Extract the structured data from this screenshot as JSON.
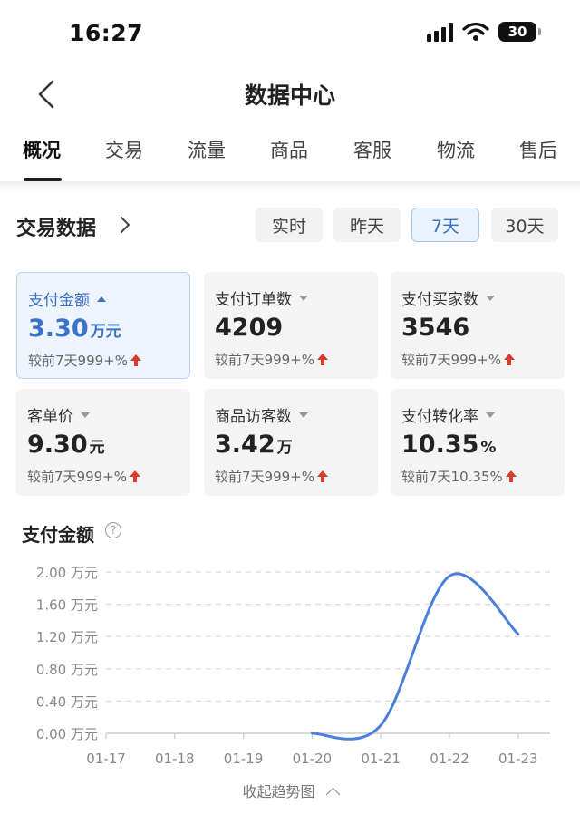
{
  "status_bar": {
    "time": "16:27",
    "battery": "30"
  },
  "nav": {
    "title": "数据中心"
  },
  "tabs": [
    {
      "label": "概况",
      "active": true
    },
    {
      "label": "交易"
    },
    {
      "label": "流量"
    },
    {
      "label": "商品"
    },
    {
      "label": "客服"
    },
    {
      "label": "物流"
    },
    {
      "label": "售后"
    }
  ],
  "section": {
    "title": "交易数据",
    "ranges": [
      {
        "label": "实时"
      },
      {
        "label": "昨天"
      },
      {
        "label": "7天",
        "active": true
      },
      {
        "label": "30天"
      }
    ]
  },
  "metrics": [
    {
      "label": "支付金额",
      "value": "3.30",
      "unit": "万元",
      "compare": "较前7天999+%",
      "active": true
    },
    {
      "label": "支付订单数",
      "value": "4209",
      "unit": "",
      "compare": "较前7天999+%"
    },
    {
      "label": "支付买家数",
      "value": "3546",
      "unit": "",
      "compare": "较前7天999+%"
    },
    {
      "label": "客单价",
      "value": "9.30",
      "unit": "元",
      "compare": "较前7天999+%"
    },
    {
      "label": "商品访客数",
      "value": "3.42",
      "unit": "万",
      "compare": "较前7天999+%"
    },
    {
      "label": "支付转化率",
      "value": "10.35",
      "unit": "%",
      "compare": "较前7天10.35%"
    }
  ],
  "chart": {
    "title": "支付金额",
    "help_icon": "question-circle-icon",
    "collapse_label": "收起趋势图"
  },
  "chart_data": {
    "type": "line",
    "title": "支付金额",
    "categories": [
      "01-17",
      "01-18",
      "01-19",
      "01-20",
      "01-21",
      "01-22",
      "01-23"
    ],
    "y_tick_labels": [
      "0.00 万元",
      "0.40 万元",
      "0.80 万元",
      "1.20 万元",
      "1.60 万元",
      "2.00 万元"
    ],
    "ylim": [
      0,
      2.0
    ],
    "grid": true,
    "series": [
      {
        "values": [
          null,
          null,
          null,
          0.0,
          0.1,
          1.95,
          1.23
        ],
        "color": "#4a7fdc"
      }
    ]
  }
}
